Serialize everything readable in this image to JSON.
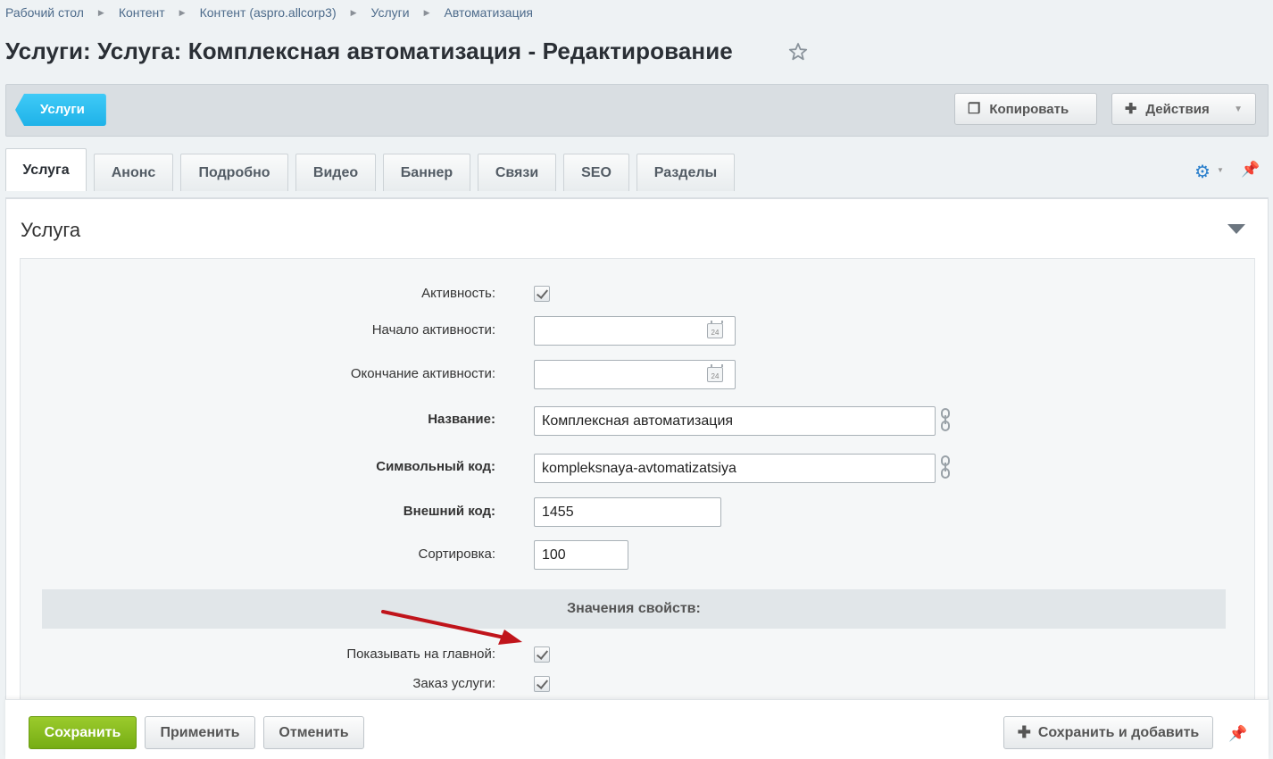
{
  "breadcrumb": [
    "Рабочий стол",
    "Контент",
    "Контент (aspro.allcorp3)",
    "Услуги",
    "Автоматизация"
  ],
  "page_title": "Услуги: Услуга: Комплексная автоматизация - Редактирование",
  "toolbar": {
    "back_label": "Услуги",
    "copy_label": "Копировать",
    "actions_label": "Действия"
  },
  "tabs": [
    "Услуга",
    "Анонс",
    "Подробно",
    "Видео",
    "Баннер",
    "Связи",
    "SEO",
    "Разделы"
  ],
  "section_title": "Услуга",
  "form": {
    "active_label": "Активность:",
    "active_checked": true,
    "start_label": "Начало активности:",
    "start_value": "",
    "end_label": "Окончание активности:",
    "end_value": "",
    "calendar_day": "24",
    "name_label": "Название:",
    "name_value": "Комплексная автоматизация",
    "code_label": "Символьный код:",
    "code_value": "kompleksnaya-avtomatizatsiya",
    "ext_label": "Внешний код:",
    "ext_value": "1455",
    "sort_label": "Сортировка:",
    "sort_value": "100",
    "props_header": "Значения свойств:",
    "show_main_label": "Показывать на главной:",
    "show_main_checked": true,
    "order_label": "Заказ услуги:",
    "order_checked": true
  },
  "footer": {
    "save_label": "Сохранить",
    "apply_label": "Применить",
    "cancel_label": "Отменить",
    "save_add_label": "Сохранить и добавить"
  },
  "colors": {
    "accent": "#2fc6f6",
    "save_green": "#86bc1e",
    "arrow_red": "#c0141b"
  }
}
